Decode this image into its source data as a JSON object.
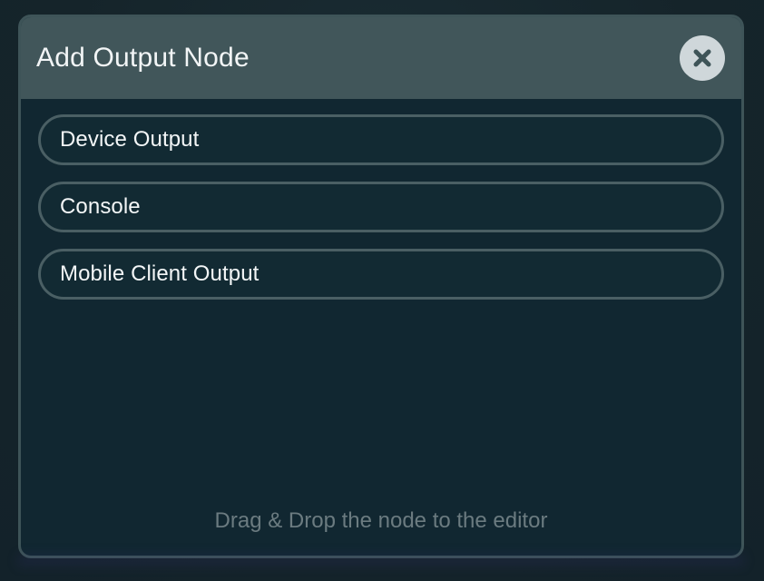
{
  "modal": {
    "title": "Add Output Node",
    "close_icon": "close-icon",
    "items": [
      {
        "label": "Device Output"
      },
      {
        "label": "Console"
      },
      {
        "label": "Mobile Client Output"
      }
    ],
    "hint": "Drag & Drop the node to the editor"
  },
  "theme": {
    "page_bg": "#16252c",
    "modal_bg": "#112731",
    "header_bg": "#41565a",
    "border": "#3e5458",
    "close_bg": "#cfd7da",
    "text": "#f3f6f7",
    "hint_text": "#6b7b80"
  }
}
